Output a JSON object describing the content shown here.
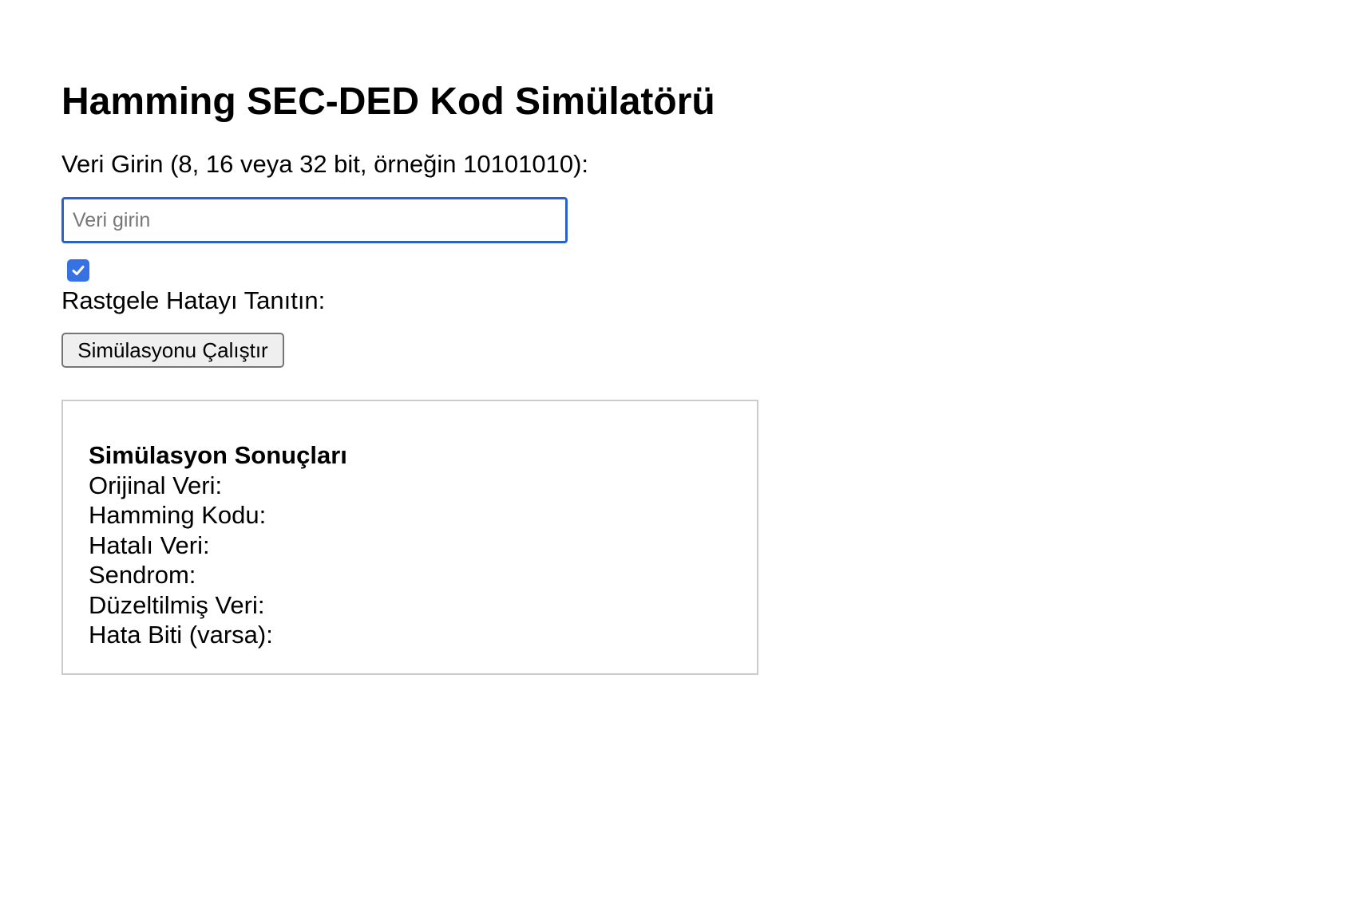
{
  "page": {
    "title": "Hamming SEC-DED Kod Simülatörü"
  },
  "form": {
    "data_label": "Veri Girin (8, 16 veya 32 bit, örneğin 10101010):",
    "data_input": {
      "value": "",
      "placeholder": "Veri girin"
    },
    "random_error": {
      "checked": true,
      "label": "Rastgele Hatayı Tanıtın:"
    },
    "run_button_label": "Simülasyonu Çalıştır"
  },
  "results": {
    "title": "Simülasyon Sonuçları",
    "rows": [
      {
        "label": "Orijinal Veri:",
        "value": ""
      },
      {
        "label": "Hamming Kodu:",
        "value": ""
      },
      {
        "label": "Hatalı Veri:",
        "value": ""
      },
      {
        "label": "Sendrom:",
        "value": ""
      },
      {
        "label": "Düzeltilmiş Veri:",
        "value": ""
      },
      {
        "label": "Hata Biti (varsa):",
        "value": ""
      }
    ]
  },
  "colors": {
    "input_focus_border": "#2b62c8",
    "checkbox_checked": "#3772e4",
    "results_border": "#cccccc"
  },
  "icons": {
    "checkbox": "checkmark-icon"
  }
}
